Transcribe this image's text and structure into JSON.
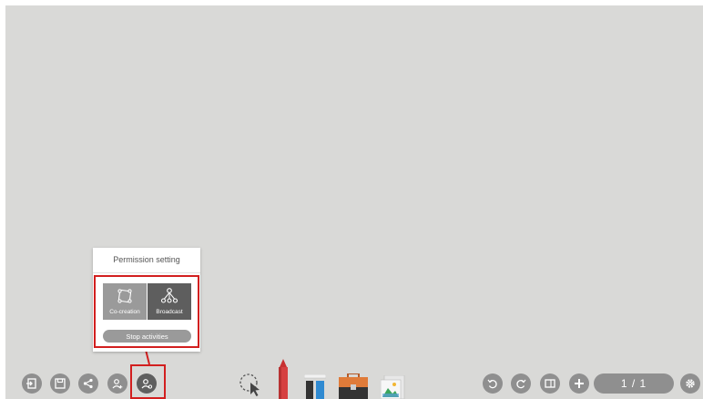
{
  "popup": {
    "title": "Permission setting",
    "co_creation_label": "Co-creation",
    "broadcast_label": "Broadcast",
    "stop_label": "Stop activities"
  },
  "left_toolbar": {
    "icons": [
      "exit-icon",
      "save-icon",
      "share-icon",
      "add-user-icon",
      "permission-icon"
    ]
  },
  "center_tools": {
    "icons": [
      "select-icon",
      "pen-icon",
      "shape-icon",
      "toolbox-icon",
      "image-icon"
    ]
  },
  "right_toolbar": {
    "icons": [
      "undo-icon",
      "redo-icon",
      "page-view-icon",
      "add-page-icon",
      "settings-icon"
    ],
    "page_indicator": "1 / 1"
  },
  "colors": {
    "canvas": "#d9d9d7",
    "button": "#8f8f8f",
    "highlight": "#d21f1f",
    "broadcast_selected": "#5e5e5e"
  }
}
